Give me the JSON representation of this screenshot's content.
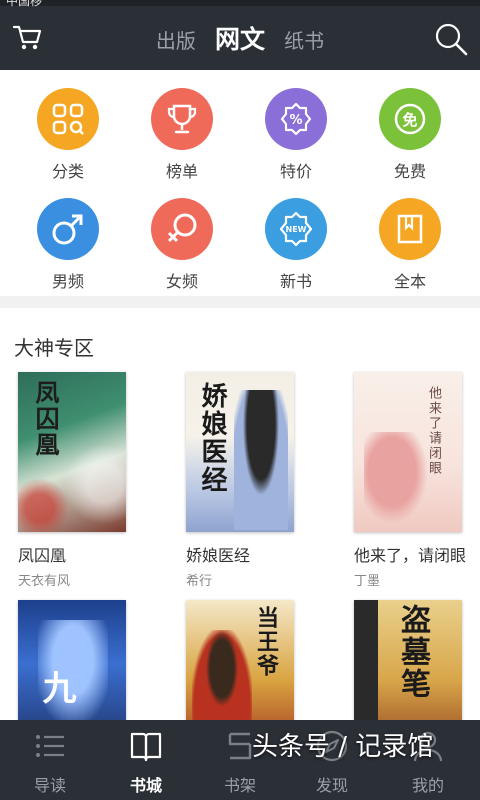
{
  "status": {
    "text": "中国移"
  },
  "header": {
    "tabs": [
      {
        "label": "出版"
      },
      {
        "label": "网文"
      },
      {
        "label": "纸书"
      }
    ],
    "cart_icon": "cart-icon",
    "search_icon": "search-icon"
  },
  "categories": [
    {
      "label": "分类",
      "icon": "grid-icon",
      "color": "#f5a623"
    },
    {
      "label": "榜单",
      "icon": "trophy-icon",
      "color": "#f06a5a"
    },
    {
      "label": "特价",
      "icon": "percent-icon",
      "color": "#8a6fd8"
    },
    {
      "label": "免费",
      "icon": "free-icon",
      "color": "#7cc13a"
    },
    {
      "label": "男频",
      "icon": "male-icon",
      "color": "#3a8fe0"
    },
    {
      "label": "女频",
      "icon": "female-icon",
      "color": "#f06a5a"
    },
    {
      "label": "新书",
      "icon": "new-icon",
      "color": "#3a9ee0"
    },
    {
      "label": "全本",
      "icon": "book-icon",
      "color": "#f5a623"
    }
  ],
  "section": {
    "title": "大神专区"
  },
  "books": [
    {
      "name": "凤囚凰",
      "author": "天衣有风",
      "cover_text": "凤囚凰"
    },
    {
      "name": "娇娘医经",
      "author": "希行",
      "cover_text": "娇娘医经"
    },
    {
      "name": "他来了，请闭眼",
      "author": "丁墨",
      "cover_text": "他来了请闭眼"
    },
    {
      "name": "",
      "author": "",
      "cover_text": "九"
    },
    {
      "name": "",
      "author": "",
      "cover_text": "当王爷"
    },
    {
      "name": "",
      "author": "",
      "cover_text": "盗墓笔"
    }
  ],
  "bottom_nav": [
    {
      "label": "导读",
      "icon": "list-icon"
    },
    {
      "label": "书城",
      "icon": "open-book-icon"
    },
    {
      "label": "书架",
      "icon": "shelf-icon"
    },
    {
      "label": "发现",
      "icon": "compass-icon"
    },
    {
      "label": "我的",
      "icon": "person-icon"
    }
  ],
  "watermark": {
    "text": "头条号 / 记录馆"
  }
}
